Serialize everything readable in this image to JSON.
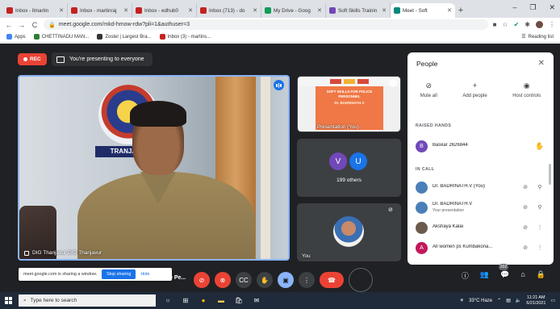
{
  "browser": {
    "tabs": [
      {
        "label": "Inbox - llmartin",
        "fav_color": "#c5221f",
        "active": false
      },
      {
        "label": "Inbox - martinraj",
        "fav_color": "#c5221f",
        "active": false
      },
      {
        "label": "Inbox - edhub0",
        "fav_color": "#c5221f",
        "active": false
      },
      {
        "label": "Inbox (713) - do",
        "fav_color": "#c5221f",
        "active": false
      },
      {
        "label": "My Drive - Goog",
        "fav_color": "#0f9d58",
        "active": false
      },
      {
        "label": "Soft Skills Trainin",
        "fav_color": "#7248b9",
        "active": false
      },
      {
        "label": "Meet - Soft",
        "fav_color": "#00897b",
        "active": true
      }
    ],
    "new_tab": "+",
    "window_controls": [
      "–",
      "❐",
      "✕"
    ],
    "url": "meet.google.com/mkd-hmow-rdw?pli=1&authuser=3",
    "back": "←",
    "forward": "→",
    "reload": "C",
    "bookmarks": [
      {
        "label": "Apps",
        "color": "#4285f4"
      },
      {
        "label": "CHETTINADU MAN...",
        "color": "#2e7d32"
      },
      {
        "label": "Zostel | Largest Bra...",
        "color": "#333333"
      },
      {
        "label": "Inbox (3) - martins...",
        "color": "#c5221f"
      }
    ],
    "reading_list": "Reading list"
  },
  "meet": {
    "rec_label": "REC",
    "presenting_text": "You're presenting to everyone",
    "main_sign": "TRANJAVUR",
    "main_label": "DIG Thanjavur DIG Thanjavur",
    "slide": {
      "line1": "SOFT SKILLS FOR POLICE PERSONNEL",
      "line2": "Dr. BADRINATH.V"
    },
    "presentation_label": "Presentation (You)",
    "others_initials": [
      "V",
      "U"
    ],
    "others_colors": [
      "#7248b9",
      "#1a73e8"
    ],
    "others_count": "199 others",
    "you_label": "You",
    "people_panel": {
      "title": "People",
      "close": "✕",
      "actions": [
        {
          "icon": "⊘",
          "label": "Mute all"
        },
        {
          "icon": "+",
          "label": "Add people"
        },
        {
          "icon": "◉",
          "label": "Host controls"
        }
      ],
      "raised_hands_heading": "RAISED HANDS",
      "raised": [
        {
          "initial": "B",
          "color": "#7248b9",
          "name": "Baskar 2626844",
          "icon": "✋"
        }
      ],
      "in_call_heading": "IN CALL",
      "in_call": [
        {
          "initial": "",
          "color": "#4a7fb8",
          "name": "Dr. BADRINATH.V (You)",
          "sub": "",
          "icon1": "⊘",
          "icon2": "⚲"
        },
        {
          "initial": "",
          "color": "#4a7fb8",
          "name": "Dr. BADRINATH.V",
          "sub": "Your presentation",
          "icon1": "⊘",
          "icon2": "⚲"
        },
        {
          "initial": "",
          "color": "#6b5b4d",
          "name": "Akshaya Kalai",
          "sub": "",
          "icon1": "⊘",
          "icon2": "⋮"
        },
        {
          "initial": "A",
          "color": "#c2185b",
          "name": "All women ps Kumbakona...",
          "sub": "",
          "icon1": "⊘",
          "icon2": "⋮"
        }
      ]
    },
    "sharing_bar": {
      "text": "meet.google.com is sharing a window.",
      "stop": "Stop sharing",
      "hide": "Hide"
    },
    "meeting_name": "e Pe...",
    "people_count": "202"
  },
  "taskbar": {
    "search_placeholder": "Type here to search",
    "weather": "33°C Haze",
    "time": "11:21 AM",
    "date": "6/21/2021"
  }
}
